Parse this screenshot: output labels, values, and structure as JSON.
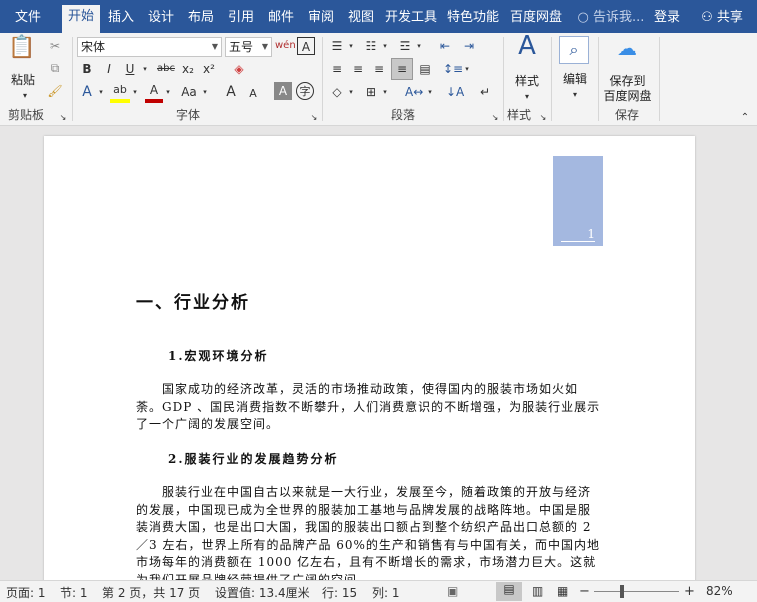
{
  "tabs": [
    "文件",
    "开始",
    "插入",
    "设计",
    "布局",
    "引用",
    "邮件",
    "审阅",
    "视图",
    "开发工具",
    "特色功能",
    "百度网盘"
  ],
  "active_tab": "开始",
  "tell_me": "告诉我...",
  "login": "登录",
  "share": "共享",
  "clipboard": {
    "paste": "粘贴",
    "group": "剪贴板"
  },
  "font": {
    "name": "宋体",
    "size": "五号",
    "group": "字体",
    "bold": "B",
    "italic": "I",
    "underline": "U",
    "strike": "abc",
    "sub": "x₂",
    "sup": "x²",
    "grow": "A",
    "shrink": "A",
    "case": "Aa",
    "highlight": "ab"
  },
  "paragraph": {
    "group": "段落"
  },
  "styles": {
    "label": "样式",
    "group": "样式"
  },
  "editing": {
    "label": "编辑"
  },
  "save": {
    "label1": "保存到",
    "label2": "百度网盘",
    "group": "保存"
  },
  "document": {
    "page_number": "1",
    "h1": "一、行业分析",
    "h2a": "1.宏观环境分析",
    "p1": "国家成功的经济改革，灵活的市场推动政策，使得国内的服装市场如火如荼。GDP 、国民消费指数不断攀升，人们消费意识的不断增强，为服装行业展示了一个广阔的发展空间。",
    "h2b": "2.服装行业的发展趋势分析",
    "p2": "服装行业在中国自古以来就是一大行业，发展至今，随着政策的开放与经济的发展，中国现已成为全世界的服装加工基地与品牌发展的战略阵地。中国是服装消费大国，也是出口大国，我国的服装出口额占到整个纺织产品出口总额的 2／3 左右，世界上所有的品牌产品 60%的生产和销售有与中国有关，而中国内地市场每年的消费额在 1000 亿左右，且有不断增长的需求，市场潜力巨大。这就为我们开展品牌经营提供了广阔的空间。"
  },
  "status": {
    "page": "页面: 1",
    "section": "节: 1",
    "pages": "第 2 页，共 17 页",
    "setting": "设置值: 13.4厘米",
    "line": "行: 15",
    "column": "列: 1",
    "zoom": "82%"
  },
  "colors": {
    "accent": "#2b579a",
    "page_box": "#a4b8e0"
  }
}
